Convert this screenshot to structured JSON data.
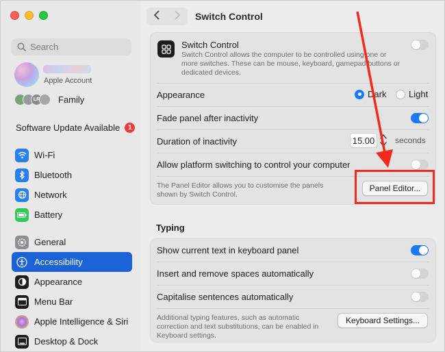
{
  "window": {
    "title": "Switch Control"
  },
  "sidebar": {
    "search_placeholder": "Search",
    "account_label": "Apple Account",
    "family_label": "Family",
    "family_initials": [
      "",
      "",
      "LR",
      ""
    ],
    "update_label": "Software Update Available",
    "update_count": "1",
    "group1": [
      {
        "label": "Wi-Fi",
        "icon": "wifi-icon"
      },
      {
        "label": "Bluetooth",
        "icon": "bluetooth-icon"
      },
      {
        "label": "Network",
        "icon": "globe-icon"
      },
      {
        "label": "Battery",
        "icon": "battery-icon"
      }
    ],
    "group2": [
      {
        "label": "General",
        "icon": "gear-icon"
      },
      {
        "label": "Accessibility",
        "icon": "accessibility-icon",
        "active": true
      },
      {
        "label": "Appearance",
        "icon": "appearance-icon"
      },
      {
        "label": "Menu Bar",
        "icon": "menubar-icon"
      },
      {
        "label": "Apple Intelligence & Siri",
        "icon": "siri-icon"
      },
      {
        "label": "Desktop & Dock",
        "icon": "dock-icon"
      }
    ]
  },
  "switch_control": {
    "title": "Switch Control",
    "description": "Switch Control allows the computer to be controlled using one or more switches. These can be mouse, keyboard, gamepad buttons or dedicated devices.",
    "enabled": false
  },
  "appearance": {
    "label": "Appearance",
    "options": [
      "Dark",
      "Light"
    ],
    "selected": "Dark"
  },
  "fade_panel": {
    "label": "Fade panel after inactivity",
    "enabled": true
  },
  "duration": {
    "label": "Duration of inactivity",
    "value": "15.00",
    "unit": "seconds"
  },
  "platform_switching": {
    "label": "Allow platform switching to control your computer",
    "enabled": false
  },
  "panel_editor": {
    "description": "The Panel Editor allows you to customise the panels shown by Switch Control.",
    "button": "Panel Editor..."
  },
  "typing": {
    "section_title": "Typing",
    "rows": [
      {
        "label": "Show current text in keyboard panel",
        "enabled": true
      },
      {
        "label": "Insert and remove spaces automatically",
        "enabled": false
      },
      {
        "label": "Capitalise sentences automatically",
        "enabled": false
      }
    ],
    "footer": "Additional typing features, such as automatic correction and text substitutions, can be enabled in Keyboard settings.",
    "button": "Keyboard Settings..."
  },
  "colors": {
    "accent": "#1a7af6",
    "sidebar_selected": "#1a62d6",
    "annotation_red": "#f3291b"
  }
}
